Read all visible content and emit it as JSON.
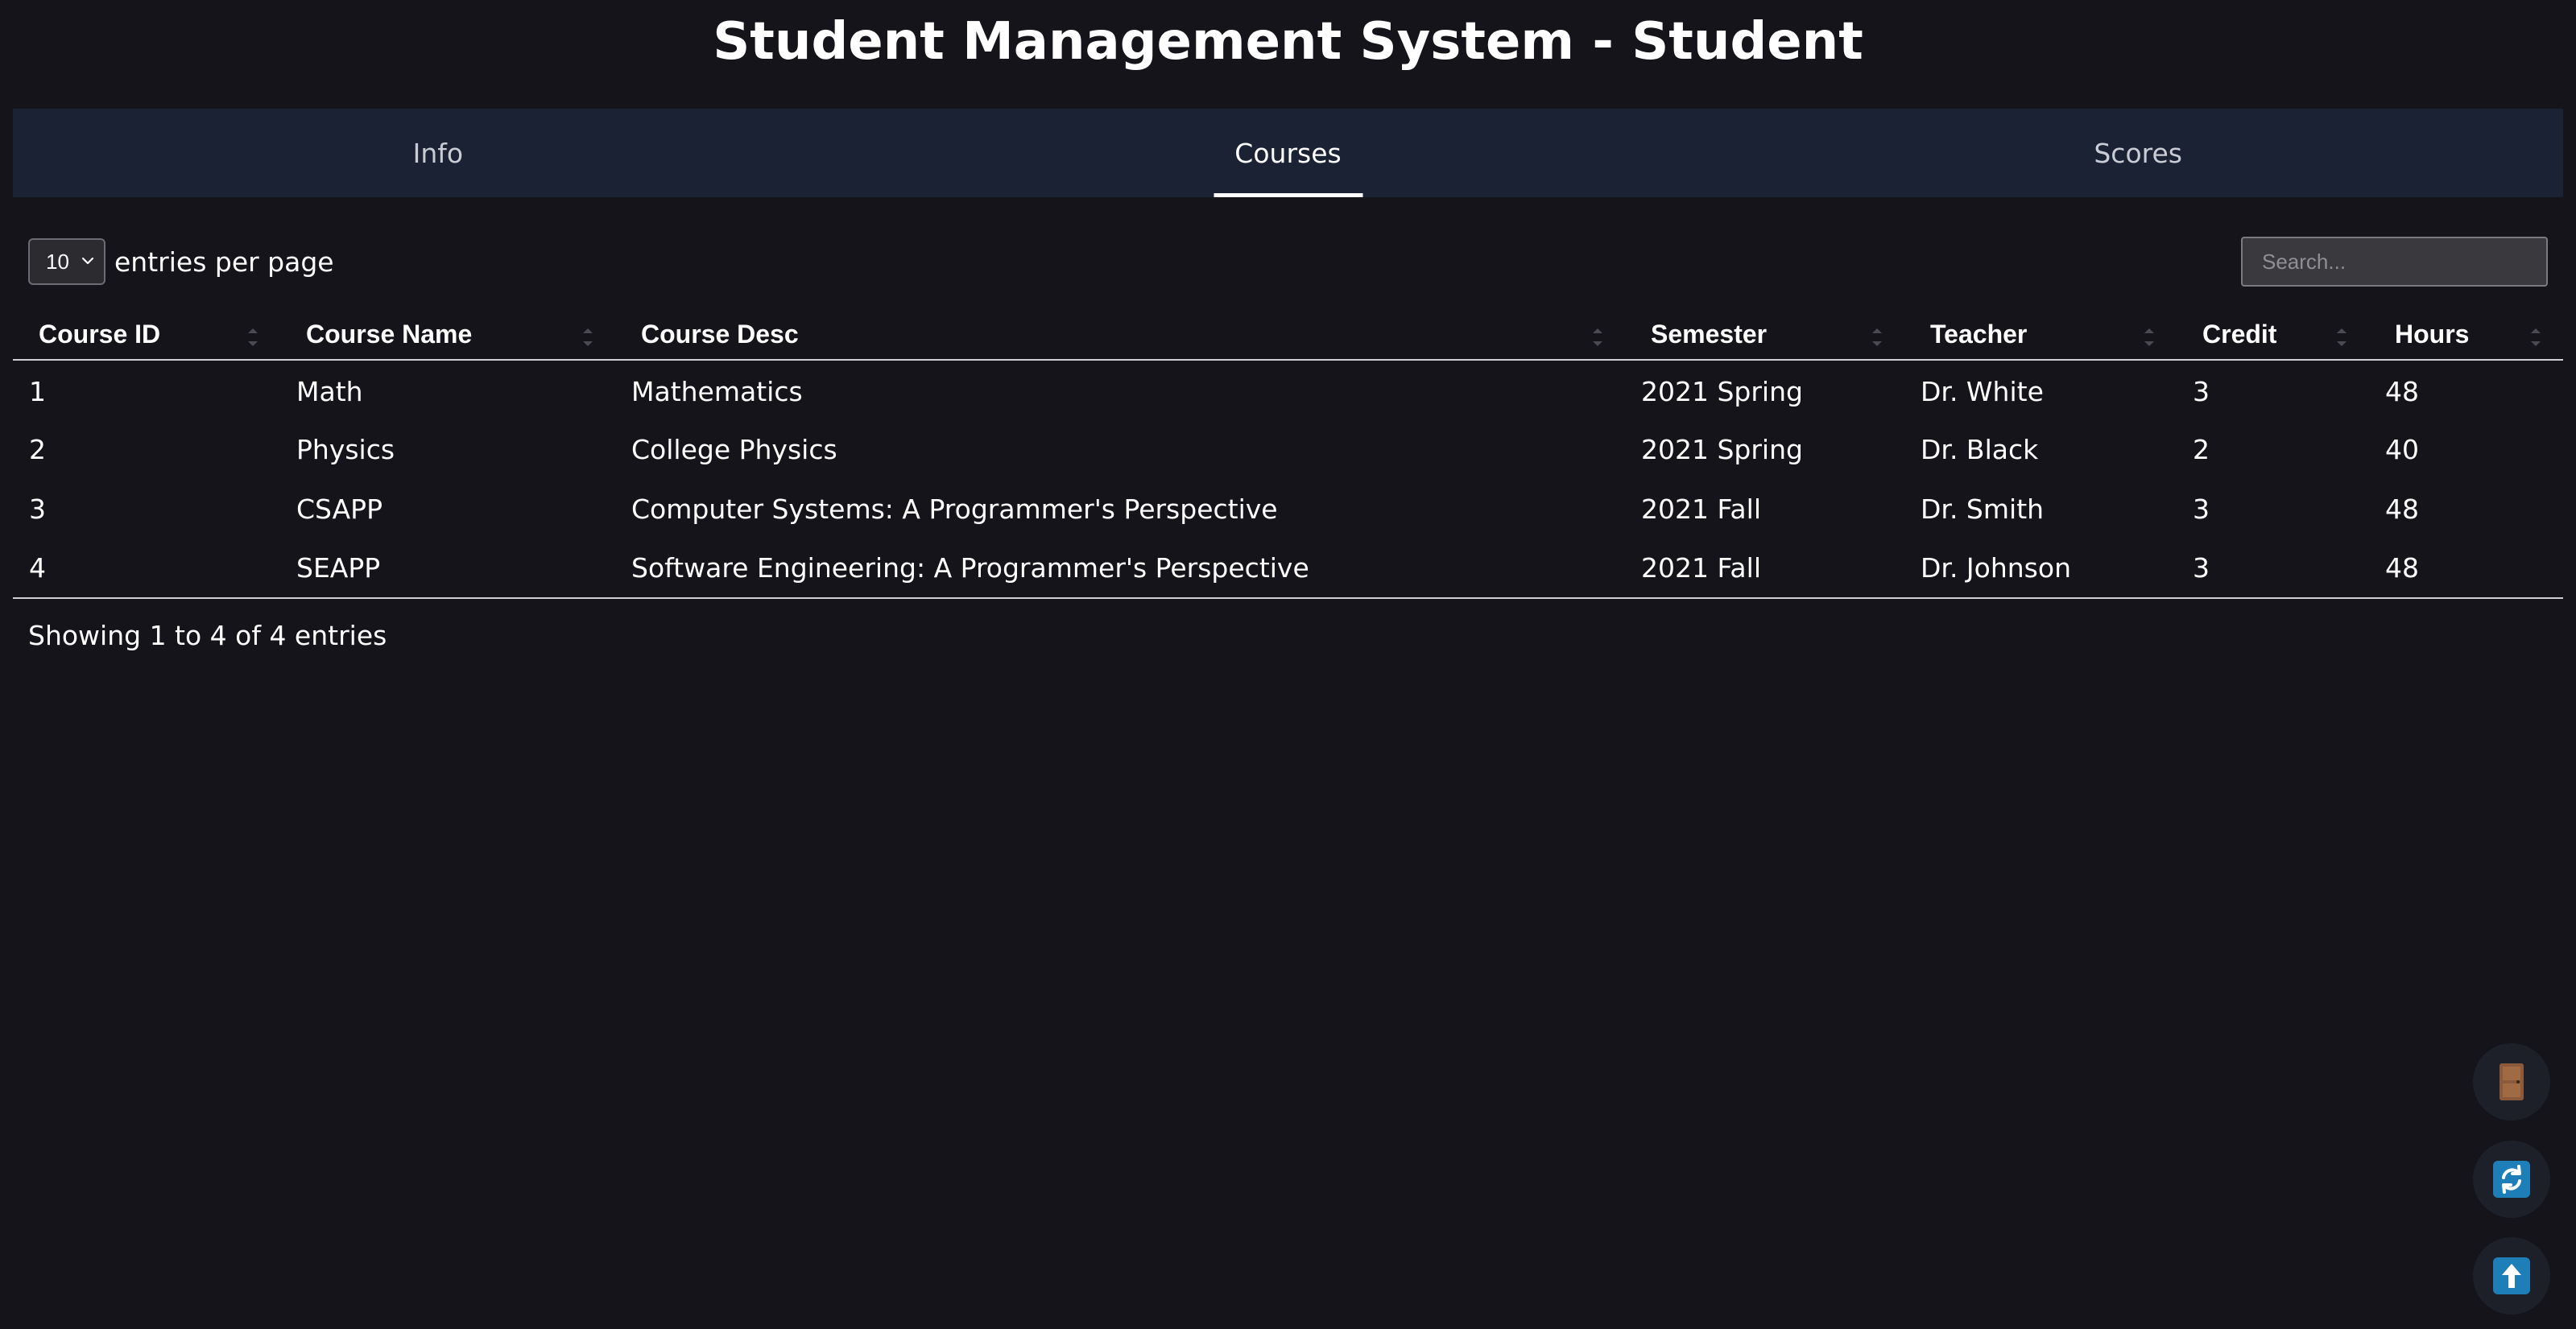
{
  "header": {
    "title": "Student Management System - Student"
  },
  "tabs": [
    {
      "label": "Info",
      "active": false
    },
    {
      "label": "Courses",
      "active": true
    },
    {
      "label": "Scores",
      "active": false
    }
  ],
  "controls": {
    "entries_value": "10",
    "entries_label": "entries per page",
    "search_placeholder": "Search..."
  },
  "table": {
    "columns": [
      "Course ID",
      "Course Name",
      "Course Desc",
      "Semester",
      "Teacher",
      "Credit",
      "Hours"
    ],
    "rows": [
      [
        "1",
        "Math",
        "Mathematics",
        "2021 Spring",
        "Dr. White",
        "3",
        "48"
      ],
      [
        "2",
        "Physics",
        "College Physics",
        "2021 Spring",
        "Dr. Black",
        "2",
        "40"
      ],
      [
        "3",
        "CSAPP",
        "Computer Systems: A Programmer's Perspective",
        "2021 Fall",
        "Dr. Smith",
        "3",
        "48"
      ],
      [
        "4",
        "SEAPP",
        "Software Engineering: A Programmer's Perspective",
        "2021 Fall",
        "Dr. Johnson",
        "3",
        "48"
      ]
    ]
  },
  "footer": {
    "info": "Showing 1 to 4 of 4 entries"
  },
  "colors": {
    "background": "#14141a",
    "tabbar": "#1b2234",
    "fab_background": "#1d2029",
    "door_icon": "#8a5a3a",
    "action_icon": "#1e7fb8"
  },
  "fabs": [
    {
      "icon": "door-icon"
    },
    {
      "icon": "refresh-icon"
    },
    {
      "icon": "arrow-up-icon"
    }
  ]
}
